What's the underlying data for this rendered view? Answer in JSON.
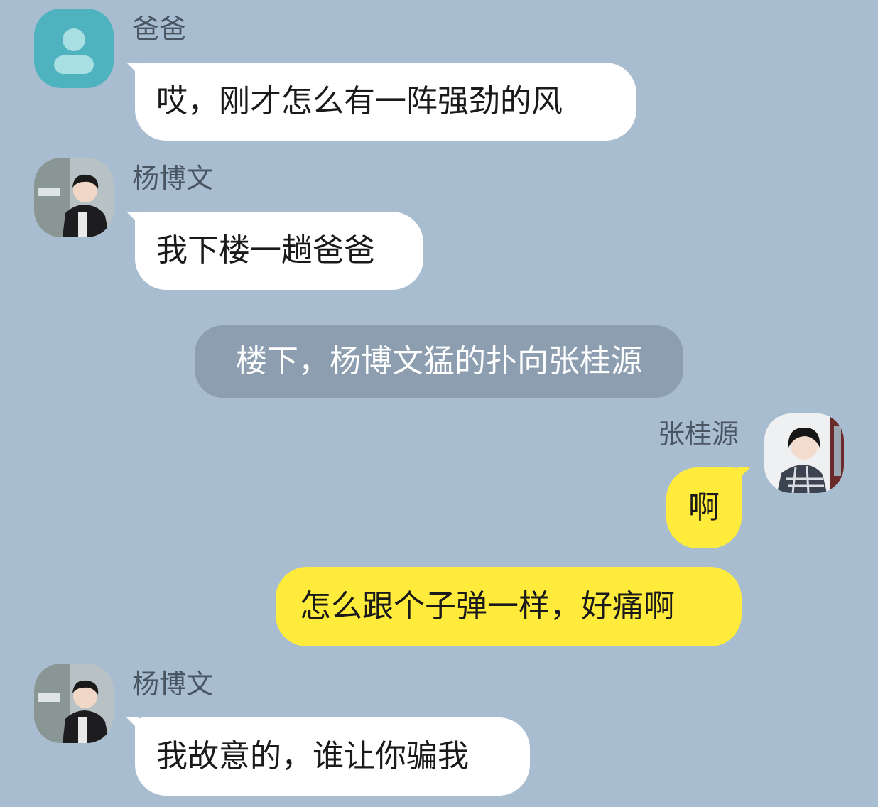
{
  "messages": [
    {
      "sender": "爸爸",
      "text": "哎，刚才怎么有一阵强劲的风"
    },
    {
      "sender": "杨博文",
      "text": "我下楼一趟爸爸"
    },
    {
      "narration": "楼下，杨博文猛的扑向张桂源"
    },
    {
      "sender": "张桂源",
      "texts": [
        "啊",
        "怎么跟个子弹一样，好痛啊"
      ]
    },
    {
      "sender": "杨博文",
      "text": "我故意的，谁让你骗我"
    }
  ],
  "colors": {
    "background": "#a9bdd1",
    "incoming_bubble": "#ffffff",
    "outgoing_bubble": "#ffeb3b",
    "narration_bubble": "#8c9eb0",
    "default_avatar": "#4fb3bf"
  },
  "icons": {
    "default_avatar": "person-icon"
  }
}
